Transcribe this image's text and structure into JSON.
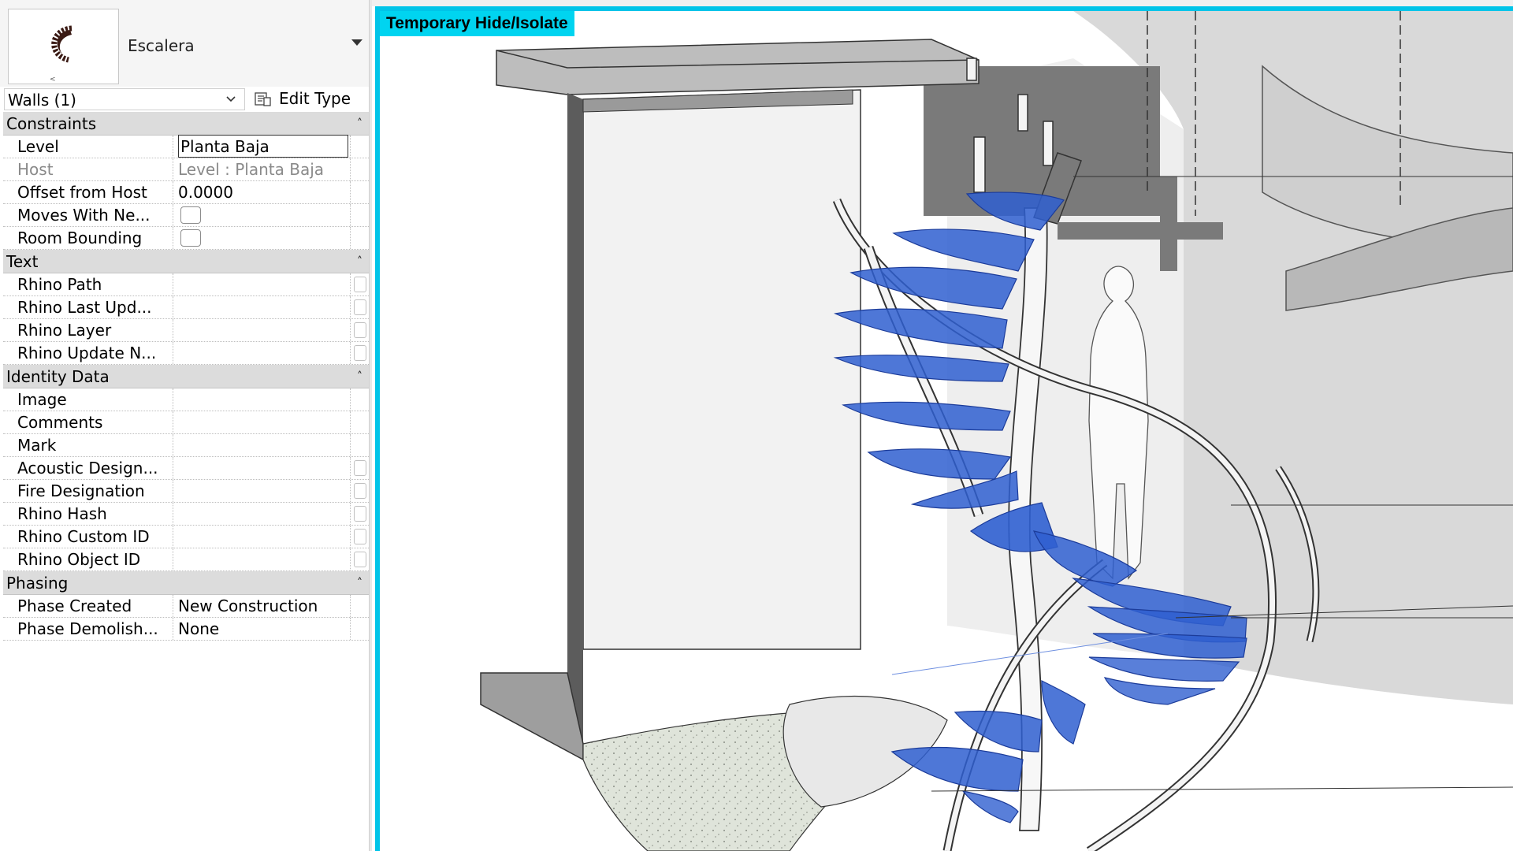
{
  "type_selector": {
    "family_name": "Escalera",
    "thumbnail_icon": "spiral-stair-thumbnail"
  },
  "filter": {
    "selected": "Walls (1)",
    "edit_type_label": "Edit Type"
  },
  "groups": [
    {
      "name": "Constraints",
      "rows": [
        {
          "name": "Level",
          "value": "Planta Baja",
          "kind": "boxed"
        },
        {
          "name": "Host",
          "value": "Level : Planta Baja",
          "kind": "readonly"
        },
        {
          "name": "Offset from Host",
          "value": "0.0000",
          "kind": "text"
        },
        {
          "name": "Moves With Ne...",
          "value": "",
          "kind": "checkbox"
        },
        {
          "name": "Room Bounding",
          "value": "",
          "kind": "checkbox"
        }
      ]
    },
    {
      "name": "Text",
      "rows": [
        {
          "name": "Rhino Path",
          "value": "",
          "kind": "button"
        },
        {
          "name": "Rhino Last Upd...",
          "value": "",
          "kind": "button"
        },
        {
          "name": "Rhino Layer",
          "value": "",
          "kind": "button"
        },
        {
          "name": "Rhino Update N...",
          "value": "",
          "kind": "button"
        }
      ]
    },
    {
      "name": "Identity Data",
      "rows": [
        {
          "name": "Image",
          "value": "",
          "kind": "text"
        },
        {
          "name": "Comments",
          "value": "",
          "kind": "text"
        },
        {
          "name": "Mark",
          "value": "",
          "kind": "text"
        },
        {
          "name": "Acoustic Design...",
          "value": "",
          "kind": "button"
        },
        {
          "name": "Fire Designation",
          "value": "",
          "kind": "button"
        },
        {
          "name": "Rhino Hash",
          "value": "",
          "kind": "button"
        },
        {
          "name": "Rhino Custom ID",
          "value": "",
          "kind": "button"
        },
        {
          "name": "Rhino Object ID",
          "value": "",
          "kind": "button"
        }
      ]
    },
    {
      "name": "Phasing",
      "rows": [
        {
          "name": "Phase Created",
          "value": "New Construction",
          "kind": "text"
        },
        {
          "name": "Phase Demolish...",
          "value": "None",
          "kind": "text"
        }
      ]
    }
  ],
  "viewport": {
    "mode_label": "Temporary Hide/Isolate",
    "accent_color": "#00c4e8",
    "tread_color": "#2f5fd0"
  }
}
